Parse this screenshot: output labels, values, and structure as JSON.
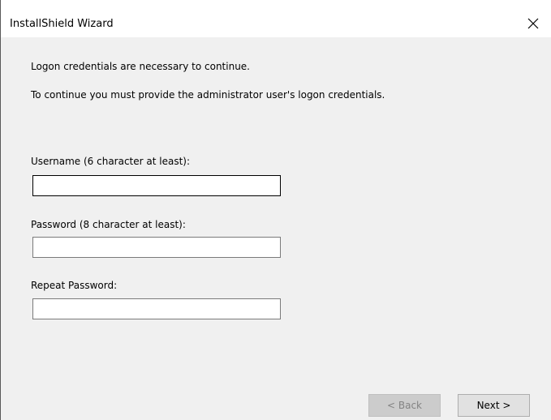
{
  "window": {
    "title": "InstallShield Wizard",
    "close_icon": "close-icon"
  },
  "intro": {
    "line1": "Logon credentials are necessary to continue.",
    "line2": "To continue you must provide the administrator user's logon credentials."
  },
  "fields": {
    "username_label": "Username (6 character at least):",
    "username_value": "",
    "password_label": "Password (8 character at least):",
    "password_value": "",
    "repeat_label": "Repeat Password:",
    "repeat_value": ""
  },
  "buttons": {
    "back_label": "< Back",
    "next_label": "Next >"
  }
}
